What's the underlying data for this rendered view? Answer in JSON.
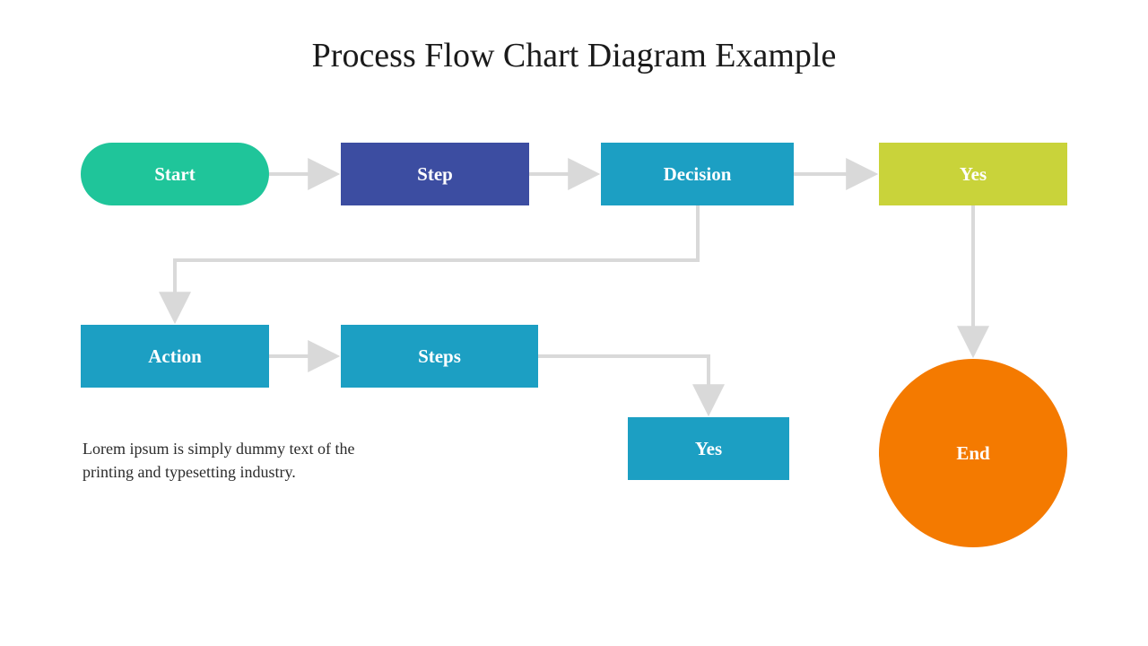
{
  "title": "Process Flow Chart Diagram Example",
  "nodes": {
    "start": "Start",
    "step": "Step",
    "decision": "Decision",
    "yes1": "Yes",
    "action": "Action",
    "steps": "Steps",
    "yes2": "Yes",
    "end": "End"
  },
  "caption": "Lorem ipsum is simply dummy text of the printing and typesetting industry.",
  "colors": {
    "start": "#1fc59a",
    "step": "#3c4da1",
    "teal": "#1c9fc3",
    "yes": "#c9d33a",
    "end": "#f47a00",
    "arrow": "#e6e6e6"
  }
}
